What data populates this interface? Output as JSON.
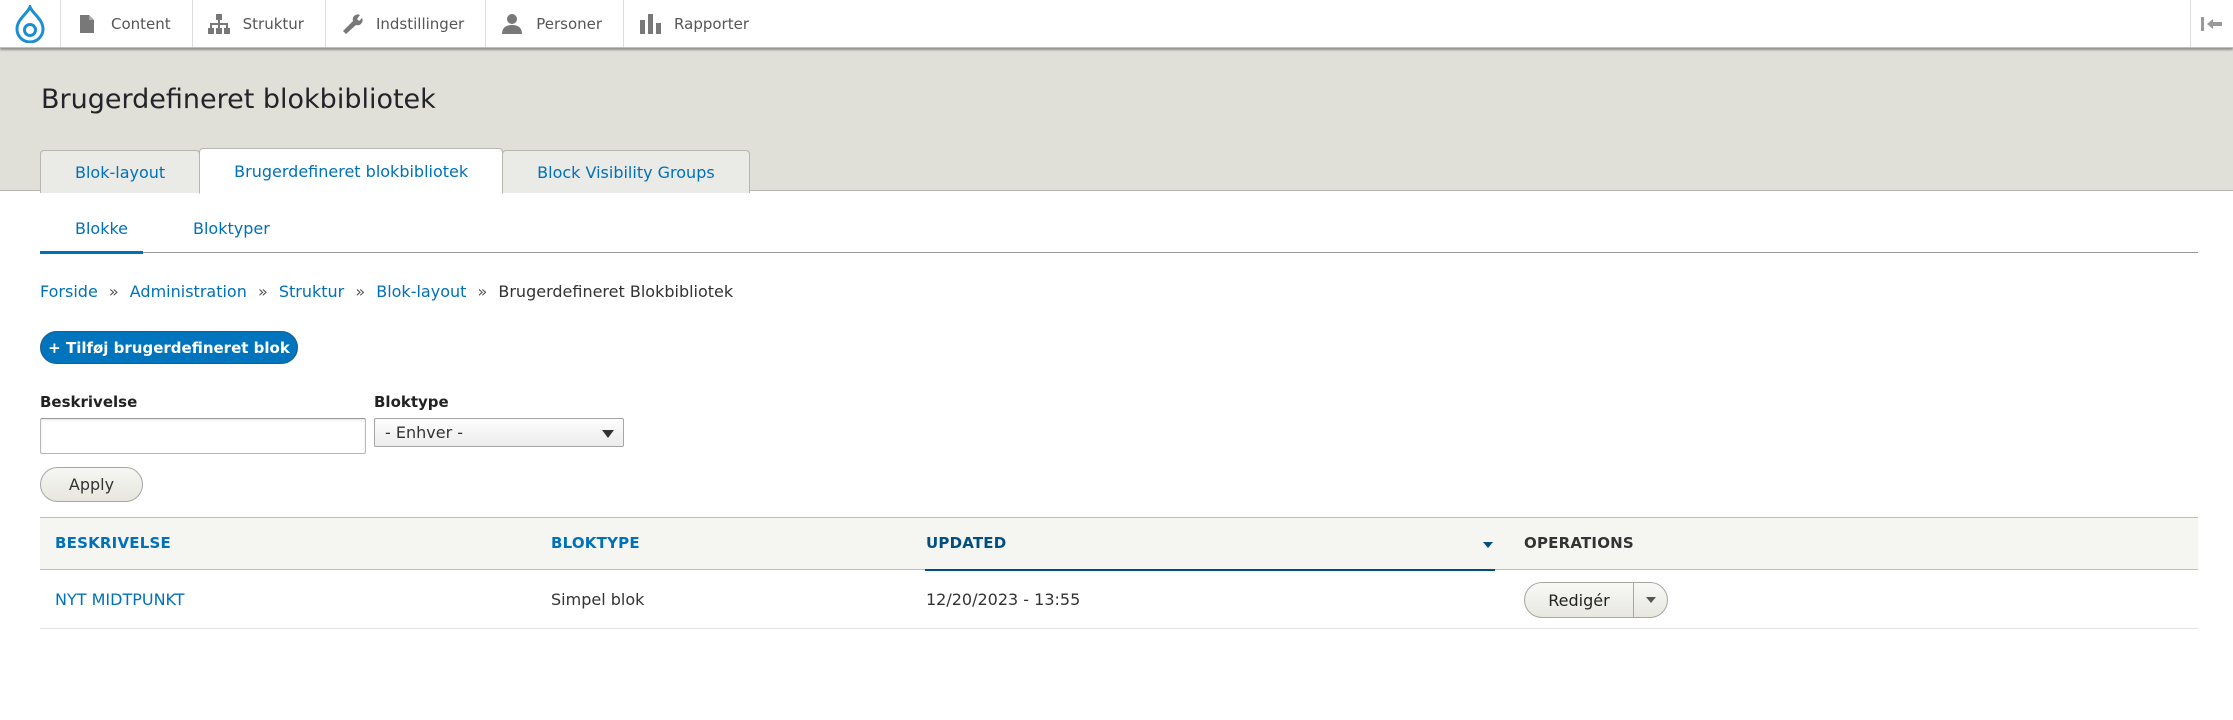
{
  "toolbar": {
    "items": [
      {
        "label": "Content",
        "icon": "file-icon"
      },
      {
        "label": "Struktur",
        "icon": "sitemap-icon"
      },
      {
        "label": "Indstillinger",
        "icon": "wrench-icon"
      },
      {
        "label": "Personer",
        "icon": "person-icon"
      },
      {
        "label": "Rapporter",
        "icon": "bar-chart-icon"
      }
    ],
    "logo_icon": "drupal-drop-icon",
    "collapse_icon": "collapse-toolbar-icon"
  },
  "page": {
    "title": "Brugerdefineret blokbibliotek"
  },
  "tabs": [
    {
      "label": "Blok-layout",
      "active": false
    },
    {
      "label": "Brugerdefineret blokbibliotek",
      "active": true
    },
    {
      "label": "Block Visibility Groups",
      "active": false
    }
  ],
  "subtabs": [
    {
      "label": "Blokke",
      "active": true
    },
    {
      "label": "Bloktyper",
      "active": false
    }
  ],
  "breadcrumb": {
    "links": [
      "Forside",
      "Administration",
      "Struktur",
      "Blok-layout"
    ],
    "current": "Brugerdefineret Blokbibliotek",
    "separator": "»"
  },
  "add_button": {
    "label": "+ Tilføj brugerdefineret blok"
  },
  "filters": {
    "description_label": "Beskrivelse",
    "description_value": "",
    "type_label": "Bloktype",
    "type_selected": "- Enhver -",
    "apply_label": "Apply"
  },
  "table": {
    "headers": [
      "BESKRIVELSE",
      "BLOKTYPE",
      "UPDATED",
      "OPERATIONS"
    ],
    "sorted_column": "UPDATED",
    "rows": [
      {
        "description": "NYT MIDTPUNKT",
        "type": "Simpel blok",
        "updated": "12/20/2023 - 13:55",
        "operation": "Redigér"
      }
    ]
  },
  "colors": {
    "accent": "#0071b8",
    "header_bg": "#e0e0d8",
    "primary_button": "#0074bd"
  }
}
